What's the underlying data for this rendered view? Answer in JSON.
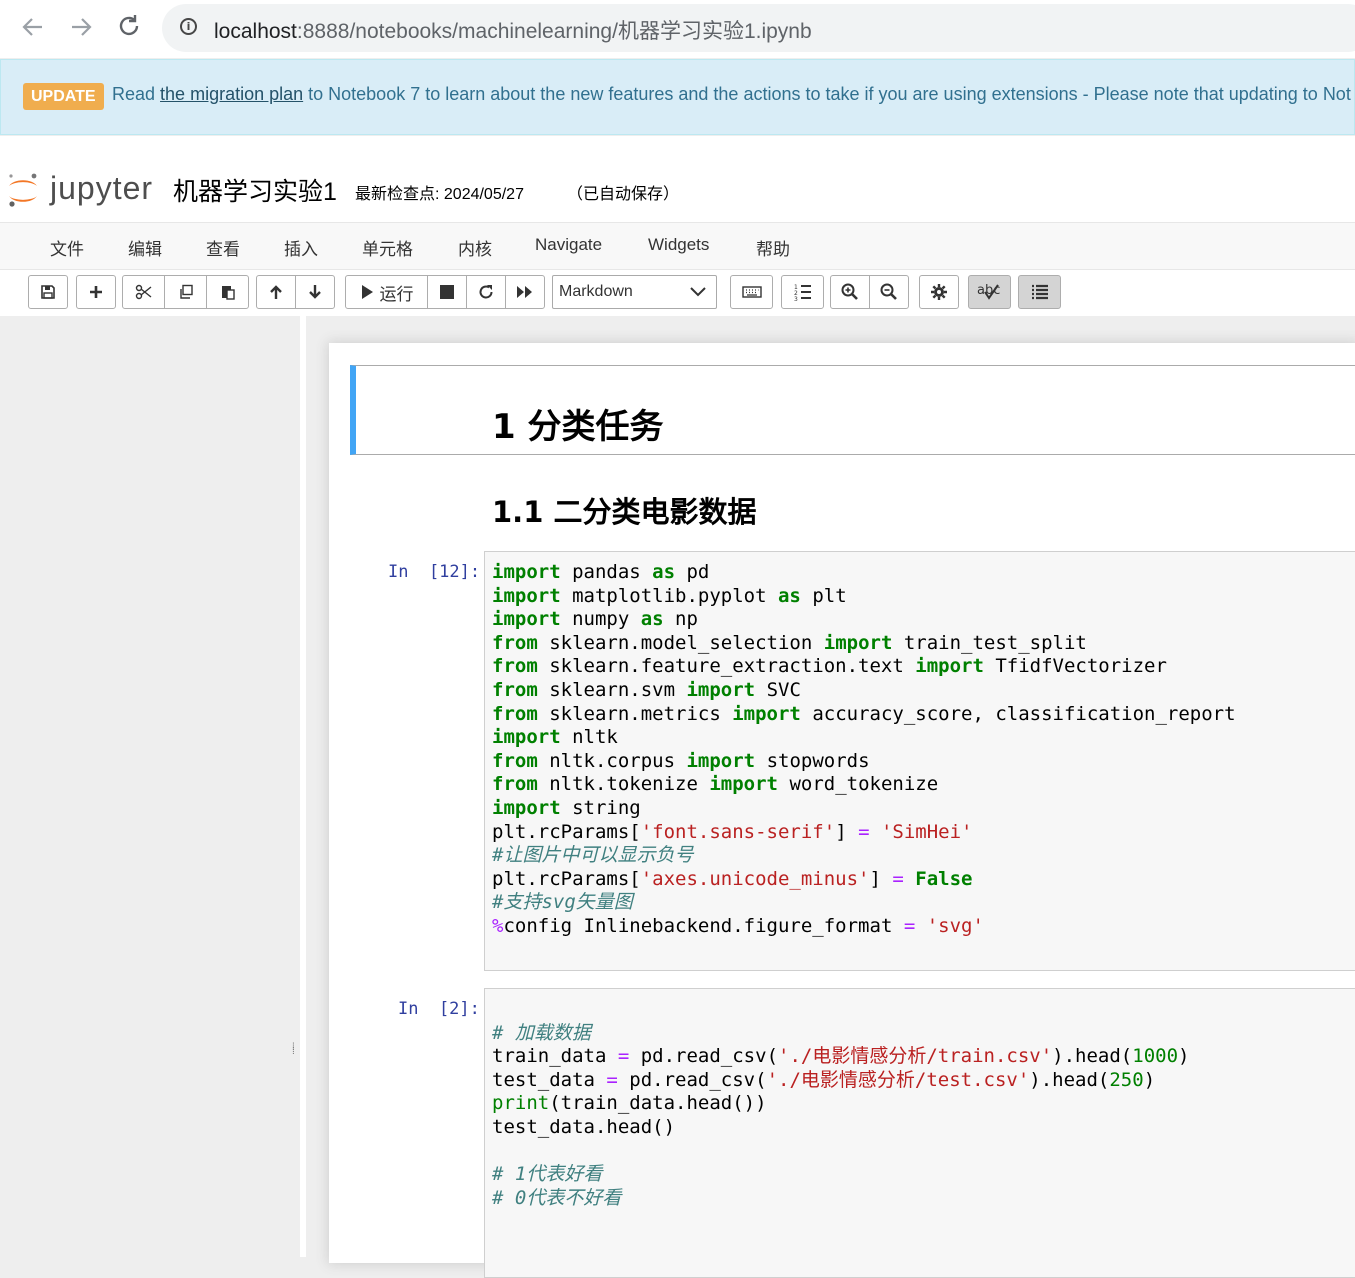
{
  "browser": {
    "back_icon": "arrow-left-icon",
    "forward_icon": "arrow-right-icon",
    "reload_icon": "reload-icon",
    "url_host": "localhost",
    "url_rest": ":8888/notebooks/machinelearning/机器学习实验1.ipynb"
  },
  "banner": {
    "badge": "UPDATE",
    "text_before": "Read ",
    "link": "the migration plan",
    "text_after": " to Notebook 7 to learn about the new features and the actions to take if you are using extensions - Please note that updating to Not"
  },
  "header": {
    "logo_text": "jupyter",
    "notebook_title": "机器学习实验1",
    "checkpoint": "最新检查点: 2024/05/27",
    "autosave": "（已自动保存）"
  },
  "menu": [
    "文件",
    "编辑",
    "查看",
    "插入",
    "单元格",
    "内核",
    "Navigate",
    "Widgets",
    "帮助"
  ],
  "toolbar": {
    "run_label": "运行",
    "cell_type": "Markdown",
    "icons": [
      "save-icon",
      "plus-icon",
      "cut-icon",
      "copy-icon",
      "paste-icon",
      "arrow-up-icon",
      "arrow-down-icon",
      "play-icon",
      "stop-icon",
      "restart-icon",
      "fast-forward-icon",
      "keyboard-icon",
      "list-numbered-icon",
      "zoom-in-icon",
      "zoom-out-icon",
      "gear-icon",
      "spellcheck-icon",
      "toc-icon"
    ]
  },
  "cells": {
    "heading1": "1  分类任务",
    "heading2": "1.1  二分类电影数据",
    "cell1_prompt": "In  [12]:",
    "cell2_prompt": "In  [2]:",
    "cell1_lines": [
      "import pandas as pd",
      "import matplotlib.pyplot as plt",
      "import numpy as np",
      "from sklearn.model_selection import train_test_split",
      "from sklearn.feature_extraction.text import TfidfVectorizer",
      "from sklearn.svm import SVC",
      "from sklearn.metrics import accuracy_score, classification_report",
      "import nltk",
      "from nltk.corpus import stopwords",
      "from nltk.tokenize import word_tokenize",
      "import string",
      "plt.rcParams['font.sans-serif'] = 'SimHei'",
      "#让图片中可以显示负号",
      "plt.rcParams['axes.unicode_minus'] = False",
      "#支持svg矢量图",
      "%config Inlinebackend.figure_format = 'svg'"
    ],
    "cell2_lines": [
      "",
      "# 加载数据",
      "train_data = pd.read_csv('./电影情感分析/train.csv').head(1000)",
      "test_data = pd.read_csv('./电影情感分析/test.csv').head(250)",
      "print(train_data.head())",
      "test_data.head()",
      "",
      "# 1代表好看",
      "# 0代表不好看"
    ]
  }
}
